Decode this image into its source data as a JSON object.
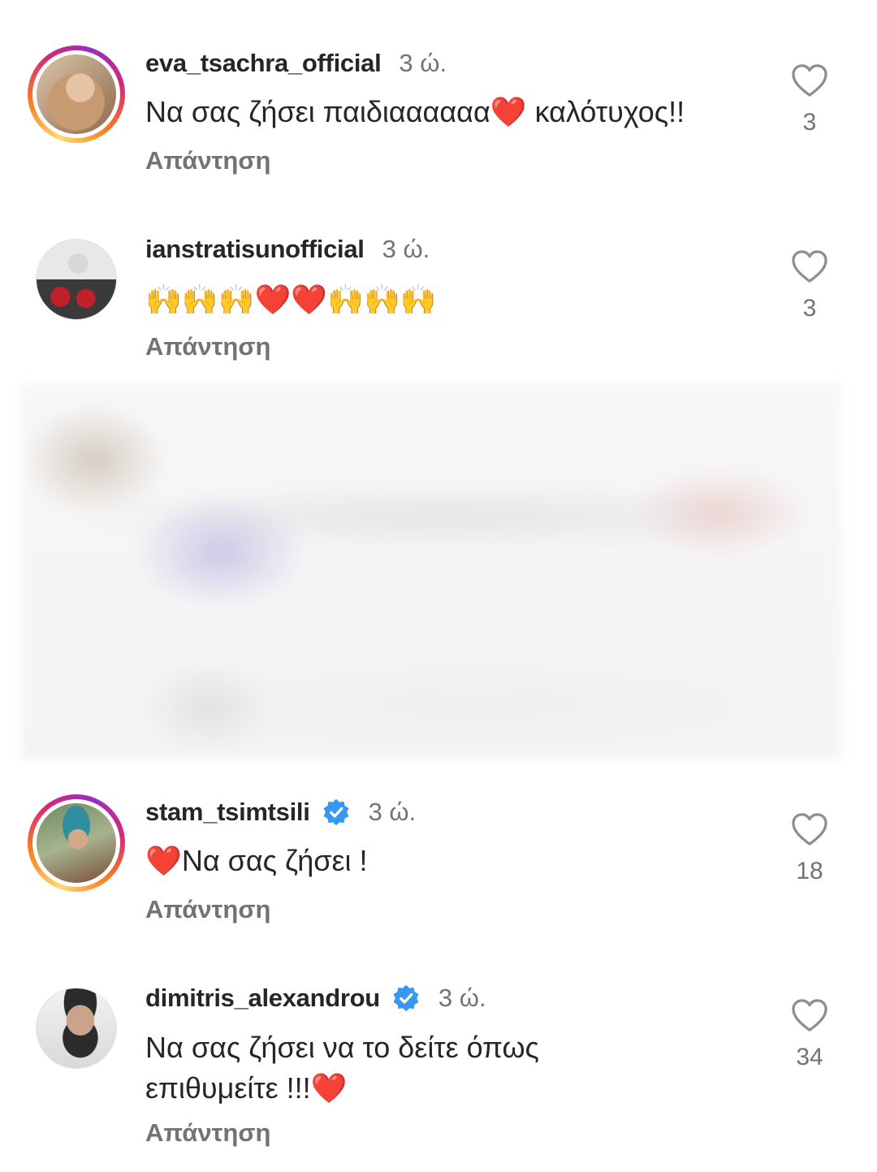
{
  "comments": [
    {
      "username": "eva_tsachra_official",
      "verified": false,
      "time": "3 ώ.",
      "text": "Να σας ζήσει παιδιαααααα❤️ καλότυχος!!",
      "reply_label": "Απάντηση",
      "likes": "3",
      "avatar": "story-ring-avatar"
    },
    {
      "username": "ianstratisunofficial",
      "verified": false,
      "time": "3 ώ.",
      "text": "🙌🙌🙌❤️❤️🙌🙌🙌",
      "reply_label": "Απάντηση",
      "likes": "3",
      "avatar": "plain-avatar"
    },
    {
      "username": "stam_tsimtsili",
      "verified": true,
      "time": "3 ώ.",
      "text": "❤️Να σας ζήσει !",
      "reply_label": "Απάντηση",
      "likes": "18",
      "avatar": "story-ring-avatar"
    },
    {
      "username": "dimitris_alexandrou",
      "verified": true,
      "time": "3 ώ.",
      "text": "Να σας ζήσει να το δείτε όπως επιθυμείτε !!!❤️",
      "reply_label": "Απάντηση",
      "likes": "34",
      "avatar": "plain-avatar"
    }
  ],
  "colors": {
    "text_primary": "#262626",
    "text_secondary": "#737373",
    "verified_badge": "#3897f0",
    "story_ring": [
      "#feda75",
      "#fa7e1e",
      "#d62976",
      "#962fbf"
    ]
  },
  "icons": {
    "like": "heart-outline-icon",
    "verified": "verified-badge-icon"
  }
}
